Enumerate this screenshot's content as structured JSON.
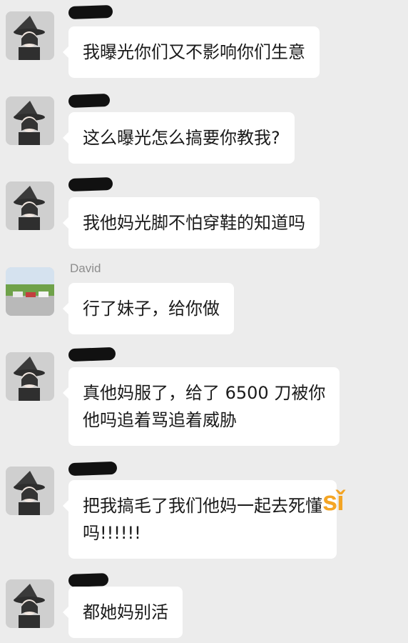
{
  "messages": [
    {
      "sender": "",
      "text": "我曝光你们又不影响你们生意"
    },
    {
      "sender": "",
      "text": "这么曝光怎么搞要你教我?"
    },
    {
      "sender": "",
      "text": "我他妈光脚不怕穿鞋的知道吗"
    },
    {
      "sender": "David",
      "text": "行了妹子，给你做"
    },
    {
      "sender": "",
      "text": "真他妈服了，给了 6500 刀被你\n他吗追着骂追着威胁"
    },
    {
      "sender": "",
      "text": "把我搞毛了我们他妈一起去死懂\n吗!!!!!!"
    },
    {
      "sender": "",
      "text": "都她妈别活"
    }
  ],
  "watermark": "sǐ"
}
